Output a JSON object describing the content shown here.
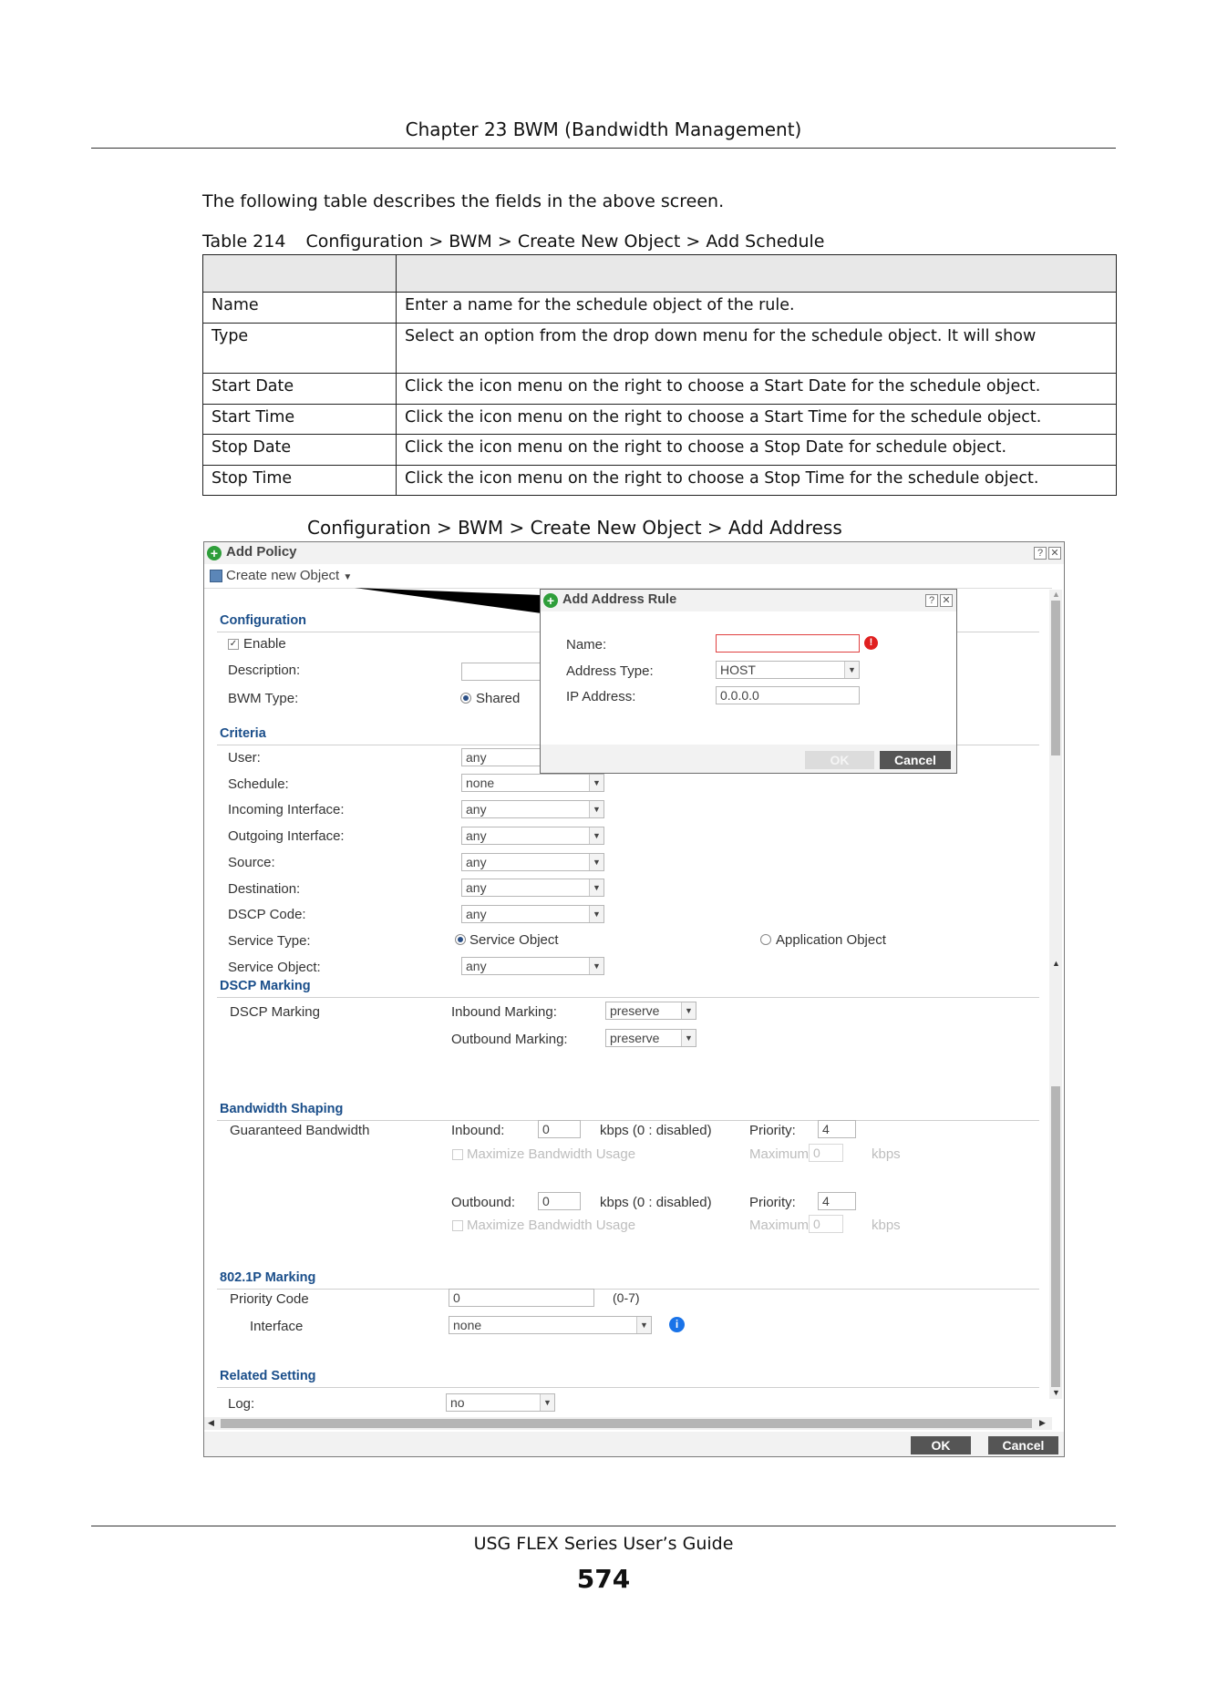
{
  "page": {
    "chapter_header": "Chapter 23 BWM (Bandwidth Management)",
    "intro": "The following table describes the fields in the above screen.",
    "table_number": "Table 214",
    "table_title": "Configuration > BWM > Create New Object > Add Schedule",
    "table_rows": [
      {
        "label": "Name",
        "description": "Enter a name for the schedule object of the rule."
      },
      {
        "label": "Type",
        "description": "Select an option from the drop down menu for the schedule object. It will show"
      },
      {
        "label": "Start Date",
        "description": "Click the icon menu on the right to choose a Start Date for the schedule object."
      },
      {
        "label": "Start Time",
        "description": "Click the icon menu on the right to choose a Start Time for the schedule object."
      },
      {
        "label": "Stop Date",
        "description": "Click the icon menu on the right to choose a Stop Date for schedule object."
      },
      {
        "label": "Stop Time",
        "description": "Click the icon menu on the right to choose a Stop Time for the schedule object."
      }
    ],
    "figure_caption": "Configuration > BWM > Create New Object > Add Address",
    "footer": "USG FLEX Series User’s Guide",
    "page_number": "574"
  },
  "window": {
    "title": "Add Policy",
    "create_new_object": "Create new Object",
    "configuration": {
      "section": "Configuration",
      "enable_label": "Enable",
      "description_label": "Description:",
      "bwm_type_label": "BWM Type:",
      "shared_label": "Shared"
    },
    "criteria": {
      "section": "Criteria",
      "user_label": "User:",
      "user_value": "any",
      "schedule_label": "Schedule:",
      "schedule_value": "none",
      "incoming_label": "Incoming Interface:",
      "incoming_value": "any",
      "outgoing_label": "Outgoing Interface:",
      "outgoing_value": "any",
      "source_label": "Source:",
      "source_value": "any",
      "destination_label": "Destination:",
      "destination_value": "any",
      "dscp_label": "DSCP Code:",
      "dscp_value": "any",
      "service_type_label": "Service Type:",
      "service_object_radio": "Service Object",
      "application_object_radio": "Application Object",
      "service_object_label": "Service Object:",
      "service_object_value": "any"
    },
    "dscp_marking": {
      "section": "DSCP Marking",
      "row_label": "DSCP Marking",
      "inbound_label": "Inbound Marking:",
      "inbound_value": "preserve",
      "outbound_label": "Outbound Marking:",
      "outbound_value": "preserve"
    },
    "bandwidth_shaping": {
      "section": "Bandwidth Shaping",
      "row_label": "Guaranteed Bandwidth",
      "inbound_label": "Inbound:",
      "inbound_value": "0",
      "kbps_note": "kbps (0 : disabled)",
      "priority_label": "Priority:",
      "inbound_priority": "4",
      "maximize_label": "Maximize Bandwidth Usage",
      "maximum_label": "Maximum:",
      "maximum_value": "0",
      "kbps": "kbps",
      "outbound_label": "Outbound:",
      "outbound_value": "0",
      "outbound_priority": "4"
    },
    "marking_8021p": {
      "section": "802.1P Marking",
      "priority_code_label": "Priority Code",
      "priority_code_value": "0",
      "range": "(0-7)",
      "interface_label": "Interface",
      "interface_value": "none"
    },
    "related": {
      "section": "Related Setting",
      "log_label": "Log:",
      "log_value": "no"
    },
    "ok": "OK",
    "cancel": "Cancel"
  },
  "dialog": {
    "title": "Add Address Rule",
    "name_label": "Name:",
    "name_value": "",
    "address_type_label": "Address Type:",
    "address_type_value": "HOST",
    "ip_label": "IP Address:",
    "ip_value": "0.0.0.0",
    "ok": "OK",
    "cancel": "Cancel"
  },
  "colors": {
    "section_heading": "#1a4e8a",
    "button_dark": "#555555",
    "error_red": "#e02020",
    "info_blue": "#1a73e8",
    "add_green": "#2e9e3a"
  }
}
